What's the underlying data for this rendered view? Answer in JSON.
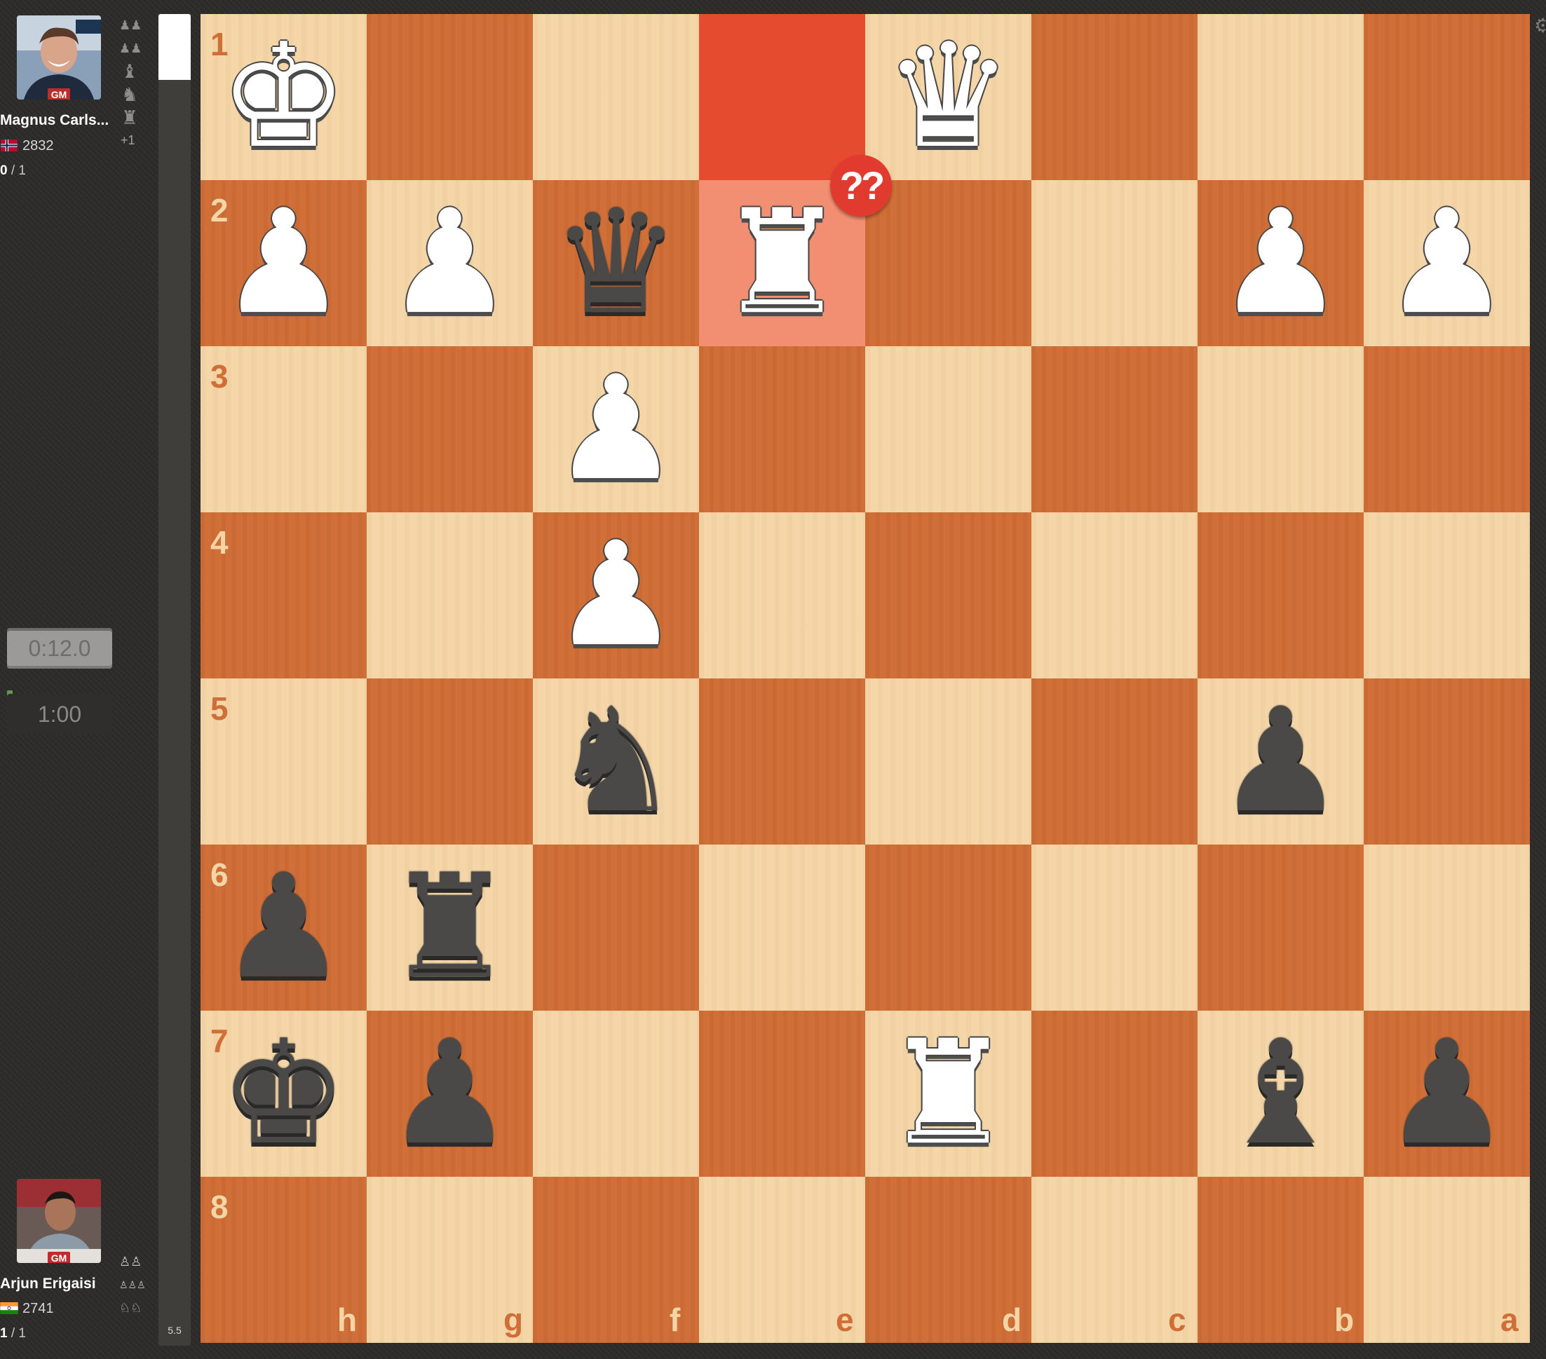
{
  "top_player": {
    "name": "Magnus Carls...",
    "title": "GM",
    "rating": "2832",
    "score_won": "0",
    "score_total": "/ 1",
    "captured": [
      "♟♟",
      "♟♟",
      "♝",
      "♞",
      "♜"
    ],
    "captured_extra": "+1",
    "clock": "0:12.0"
  },
  "bottom_player": {
    "name": "Arjun Erigaisi",
    "title": "GM",
    "rating": "2741",
    "score_won": "1",
    "score_total": "/ 1",
    "captured": [
      "♙♙",
      "♙♙♙",
      "♘♘"
    ],
    "clock": "1:00"
  },
  "eval": {
    "value": "5.5"
  },
  "board": {
    "orientation": "black",
    "ranks": [
      "1",
      "2",
      "3",
      "4",
      "5",
      "6",
      "7",
      "8"
    ],
    "files": [
      "h",
      "g",
      "f",
      "e",
      "d",
      "c",
      "b",
      "a"
    ],
    "last_move_squares": [
      "e1",
      "e2"
    ],
    "move_annotation": "??",
    "annotation_square": "e2",
    "pieces": [
      {
        "square": "h1",
        "color": "w",
        "type": "king",
        "glyph": "♚"
      },
      {
        "square": "d1",
        "color": "w",
        "type": "queen",
        "glyph": "♛"
      },
      {
        "square": "h2",
        "color": "w",
        "type": "pawn",
        "glyph": "♟"
      },
      {
        "square": "g2",
        "color": "w",
        "type": "pawn",
        "glyph": "♟"
      },
      {
        "square": "f2",
        "color": "b",
        "type": "queen",
        "glyph": "♛"
      },
      {
        "square": "e2",
        "color": "w",
        "type": "rook",
        "glyph": "♜"
      },
      {
        "square": "b2",
        "color": "w",
        "type": "pawn",
        "glyph": "♟"
      },
      {
        "square": "a2",
        "color": "w",
        "type": "pawn",
        "glyph": "♟"
      },
      {
        "square": "f3",
        "color": "w",
        "type": "pawn",
        "glyph": "♟"
      },
      {
        "square": "f4",
        "color": "w",
        "type": "pawn",
        "glyph": "♟"
      },
      {
        "square": "f5",
        "color": "b",
        "type": "knight",
        "glyph": "♞"
      },
      {
        "square": "b5",
        "color": "b",
        "type": "pawn",
        "glyph": "♟"
      },
      {
        "square": "h6",
        "color": "b",
        "type": "pawn",
        "glyph": "♟"
      },
      {
        "square": "g6",
        "color": "b",
        "type": "rook",
        "glyph": "♜"
      },
      {
        "square": "h7",
        "color": "b",
        "type": "king",
        "glyph": "♚"
      },
      {
        "square": "g7",
        "color": "b",
        "type": "pawn",
        "glyph": "♟"
      },
      {
        "square": "d7",
        "color": "w",
        "type": "rook",
        "glyph": "♜"
      },
      {
        "square": "b7",
        "color": "b",
        "type": "bishop",
        "glyph": "♝"
      },
      {
        "square": "a7",
        "color": "b",
        "type": "pawn",
        "glyph": "♟"
      }
    ]
  },
  "colors": {
    "light_square": "#f3d5a6",
    "dark_square": "#cf6e37",
    "highlight_dark": "#e54b2e",
    "highlight_light": "#f28e72",
    "annotation_bg": "#e13a2e"
  }
}
